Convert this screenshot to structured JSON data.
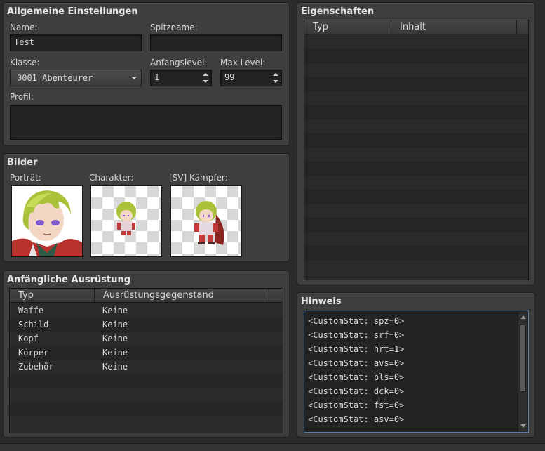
{
  "general": {
    "title": "Allgemeine Einstellungen",
    "name_label": "Name:",
    "name_value": "Test",
    "nickname_label": "Spitzname:",
    "nickname_value": "",
    "class_label": "Klasse:",
    "class_value": "0001 Abenteurer",
    "initial_level_label": "Anfangslevel:",
    "initial_level_value": "1",
    "max_level_label": "Max Level:",
    "max_level_value": "99",
    "profile_label": "Profil:",
    "profile_value": ""
  },
  "images": {
    "title": "Bilder",
    "portrait_label": "Porträt:",
    "character_label": "Charakter:",
    "battler_label": "[SV] Kämpfer:"
  },
  "equipment": {
    "title": "Anfängliche Ausrüstung",
    "columns": [
      "Typ",
      "Ausrüstungsgegenstand"
    ],
    "rows": [
      {
        "type": "Waffe",
        "item": "Keine"
      },
      {
        "type": "Schild",
        "item": "Keine"
      },
      {
        "type": "Kopf",
        "item": "Keine"
      },
      {
        "type": "Körper",
        "item": "Keine"
      },
      {
        "type": "Zubehör",
        "item": "Keine"
      }
    ]
  },
  "traits": {
    "title": "Eigenschaften",
    "columns": [
      "Typ",
      "Inhalt"
    ]
  },
  "note": {
    "title": "Hinweis",
    "lines": [
      "<CustomStat: spz=0>",
      "<CustomStat: srf=0>",
      "<CustomStat: hrt=1>",
      "<CustomStat: avs=0>",
      "<CustomStat: pls=0>",
      "<CustomStat: dck=0>",
      "<CustomStat: fst=0>",
      "<CustomStat: asv=0>"
    ]
  },
  "colors": {
    "panel_bg": "#3e3e3e",
    "field_bg": "#242424",
    "note_border": "#5b7fa6",
    "hair": "#a9c23a",
    "eyes": "#7b57c9",
    "armor": "#c23a3a"
  },
  "icons": [
    "dropdown-arrow-icon",
    "spin-up-icon",
    "spin-down-icon",
    "scroll-up-icon",
    "scroll-down-icon"
  ]
}
